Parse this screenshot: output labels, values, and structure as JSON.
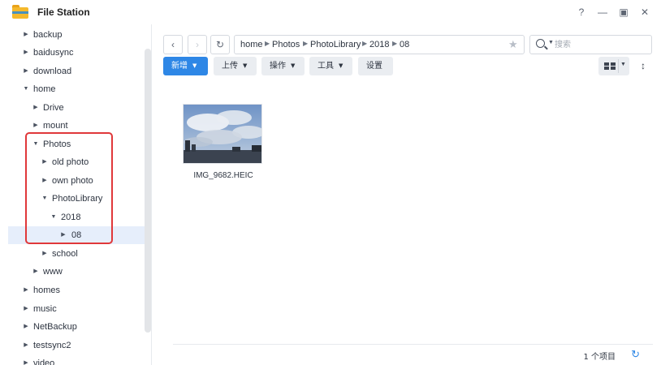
{
  "window": {
    "title": "File Station",
    "help_icon": "?",
    "minimize_icon": "—",
    "maximize_icon": "▣",
    "close_icon": "✕"
  },
  "sidebar": {
    "items": [
      {
        "label": "backup",
        "expanded": false
      },
      {
        "label": "baidusync",
        "expanded": false
      },
      {
        "label": "download",
        "expanded": false
      },
      {
        "label": "home",
        "expanded": true
      },
      {
        "label": "Drive",
        "expanded": false
      },
      {
        "label": "mount",
        "expanded": false
      },
      {
        "label": "Photos",
        "expanded": true
      },
      {
        "label": "old photo",
        "expanded": false
      },
      {
        "label": "own photo",
        "expanded": false
      },
      {
        "label": "PhotoLibrary",
        "expanded": true
      },
      {
        "label": "2018",
        "expanded": true
      },
      {
        "label": "08",
        "expanded": false,
        "selected": true
      },
      {
        "label": "school",
        "expanded": false
      },
      {
        "label": "www",
        "expanded": false
      },
      {
        "label": "homes",
        "expanded": false
      },
      {
        "label": "music",
        "expanded": false
      },
      {
        "label": "NetBackup",
        "expanded": false
      },
      {
        "label": "testsync2",
        "expanded": false
      },
      {
        "label": "video",
        "expanded": false
      }
    ],
    "arrow_collapsed": "▶",
    "arrow_expanded": "▼"
  },
  "toolbar": {
    "back_icon": "‹",
    "forward_icon": "›",
    "refresh_icon": "↻",
    "breadcrumb": [
      "home",
      "Photos",
      "PhotoLibrary",
      "2018",
      "08"
    ],
    "crumb_separator": "▶",
    "favorite_icon": "★",
    "search_placeholder": "搜索",
    "search_caret": "▼",
    "buttons": {
      "create": "新增",
      "upload": "上传",
      "action": "操作",
      "tools": "工具",
      "settings": "设置"
    },
    "caret": "▼",
    "sort_icon": "↕",
    "view_mode": "grid",
    "accent_color": "#2e87e6"
  },
  "files": [
    {
      "name": "IMG_9682.HEIC",
      "type": "image"
    }
  ],
  "status": {
    "item_count": "1 个项目",
    "refresh_icon": "↻"
  }
}
